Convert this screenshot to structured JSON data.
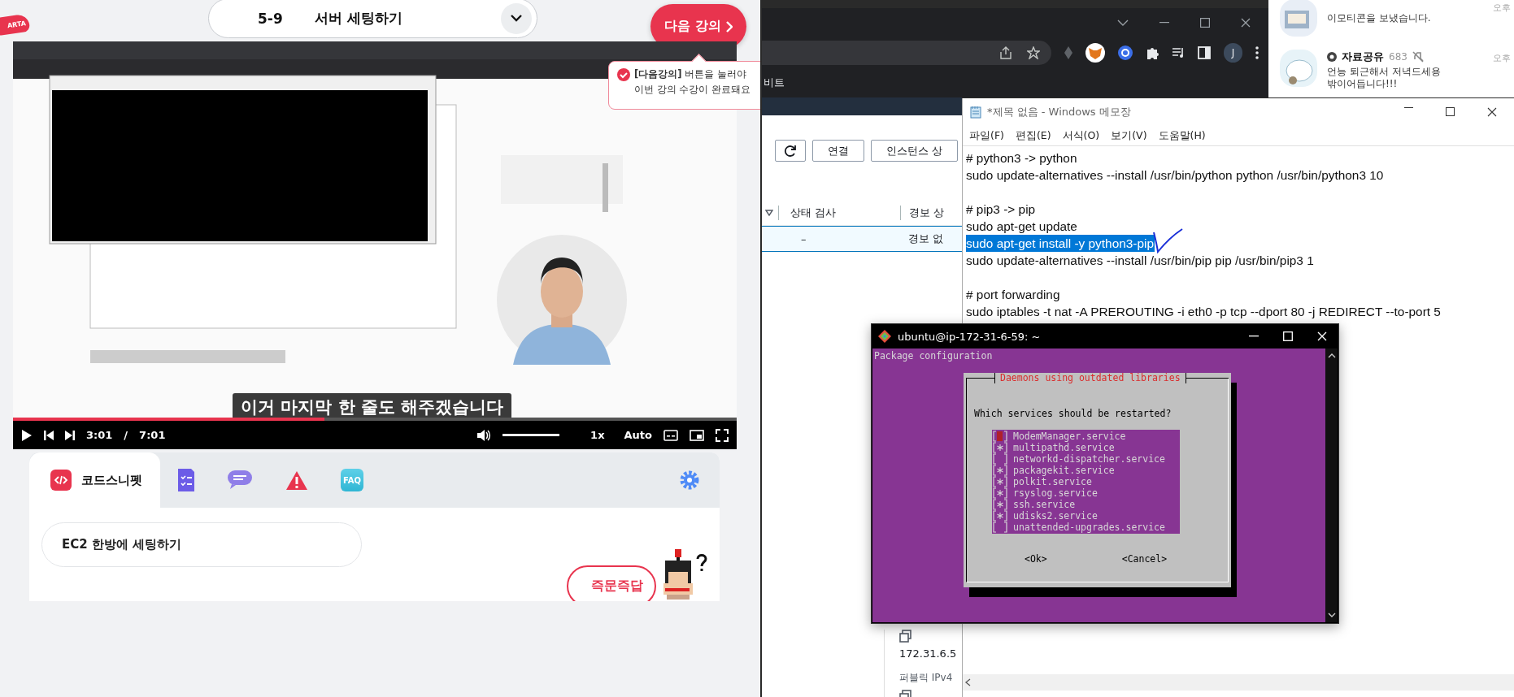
{
  "lecture_page": {
    "logo": {
      "text": "ARTA"
    },
    "lesson_selector": {
      "number": "5-9",
      "title": "서버 세팅하기"
    },
    "next_button": {
      "label": "다음 강의"
    },
    "tooltip": {
      "lines": [
        "**[다음강의]** 버튼을 눌러야",
        "이번 강의 수강이 완료돼요"
      ]
    },
    "video": {
      "kind": "picture",
      "subtitle": "이거 마지막 한 줄도 해주겠습니다",
      "progress": {
        "level": 0.43
      },
      "current_time": "3:01",
      "separator": "/",
      "duration": "7:01",
      "volume": {
        "level": 1.0
      },
      "speed": "1x",
      "quality": "Auto"
    },
    "tool_tabs": [
      {
        "kind": "snippet",
        "label": "코드스니펫",
        "selected": true
      },
      {
        "kind": "checklist",
        "selected": false
      },
      {
        "kind": "chat",
        "selected": false
      },
      {
        "kind": "warning",
        "selected": false
      },
      {
        "kind": "faq",
        "label": "FAQ",
        "selected": false
      }
    ],
    "snippet_field": {
      "value": "EC2 한방에 세팅하기"
    },
    "ask_button": {
      "label": "즉문즉답"
    }
  },
  "browser_window": {
    "bookmark": "비트",
    "avatar": "J"
  },
  "console": {
    "buttons": [
      "연결",
      "인스턴스 상"
    ],
    "columns": [
      "상태 검사",
      "경보 상"
    ],
    "row": [
      "–",
      "경보 없"
    ],
    "private_ip": "172.31.6.5",
    "public_ip_label": "퍼블릭 IPv4"
  },
  "chat_list": [
    {
      "message": "이모티콘을 보냈습니다.",
      "time": "오후",
      "muted": false
    },
    {
      "name": "자료공유",
      "count": "683",
      "muted": true,
      "message": "언능 퇴근해서  저녁드세용\n밖이어듭니다!!!",
      "time": "오후"
    }
  ],
  "notepad": {
    "title": "*제목 없음 - Windows 메모장",
    "menu": [
      "파일(F)",
      "편집(E)",
      "서식(O)",
      "보기(V)",
      "도움말(H)"
    ],
    "blocks": [
      [
        {
          "text": "# python3 -> python",
          "selected": false
        },
        {
          "text": "sudo update-alternatives --install /usr/bin/python python /usr/bin/python3 10",
          "selected": false
        }
      ],
      [
        {
          "text": "# pip3 -> pip",
          "selected": false
        },
        {
          "text": "sudo apt-get update",
          "selected": false
        },
        {
          "text": "sudo apt-get install -y python3-pip",
          "selected": true
        },
        {
          "text": "sudo update-alternatives --install /usr/bin/pip pip /usr/bin/pip3 1",
          "selected": false
        }
      ],
      [
        {
          "text": "# port forwarding",
          "selected": false
        },
        {
          "text": "sudo iptables -t nat -A PREROUTING -i eth0 -p tcp --dport 80 -j REDIRECT --to-port 5",
          "selected": false
        }
      ]
    ]
  },
  "terminal": {
    "title": "ubuntu@ip-172-31-6-59: ~",
    "header": "Package configuration",
    "dialog": {
      "title": "Daemons using outdated libraries",
      "question": "Which services should be restarted?",
      "services": [
        {
          "name": "ModemManager.service",
          "checked": false,
          "focused": true
        },
        {
          "name": "multipathd.service",
          "checked": true,
          "focused": false
        },
        {
          "name": "networkd-dispatcher.service",
          "checked": false,
          "focused": false
        },
        {
          "name": "packagekit.service",
          "checked": true,
          "focused": false
        },
        {
          "name": "polkit.service",
          "checked": true,
          "focused": false
        },
        {
          "name": "rsyslog.service",
          "checked": true,
          "focused": false
        },
        {
          "name": "ssh.service",
          "checked": true,
          "focused": false
        },
        {
          "name": "udisks2.service",
          "checked": true,
          "focused": false
        },
        {
          "name": "unattended-upgrades.service",
          "checked": false,
          "focused": false
        }
      ],
      "buttons": [
        "<Ok>",
        "<Cancel>"
      ]
    }
  }
}
